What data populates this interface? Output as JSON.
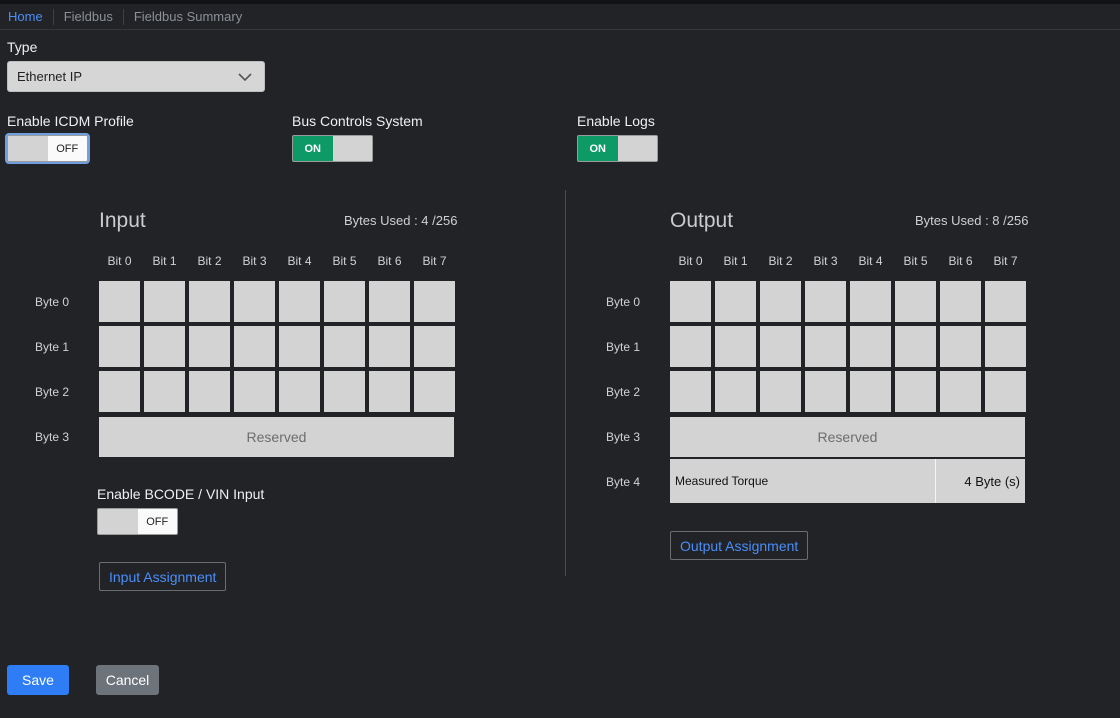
{
  "breadcrumb": [
    "Home",
    "Fieldbus",
    "Fieldbus Summary"
  ],
  "type": {
    "label": "Type",
    "value": "Ethernet IP"
  },
  "toggles": {
    "icdm": {
      "label": "Enable ICDM Profile",
      "state": "OFF"
    },
    "bus": {
      "label": "Bus Controls System",
      "state": "ON"
    },
    "logs": {
      "label": "Enable Logs",
      "state": "ON"
    }
  },
  "input": {
    "title": "Input",
    "bytes_used": "Bytes Used : 4 /256",
    "bits": [
      "Bit 0",
      "Bit 1",
      "Bit 2",
      "Bit 3",
      "Bit 4",
      "Bit 5",
      "Bit 6",
      "Bit 7"
    ],
    "bytes": [
      "Byte 0",
      "Byte 1",
      "Byte 2",
      "Byte 3"
    ],
    "reserved": "Reserved",
    "bcode_label": "Enable BCODE / VIN Input",
    "bcode_state": "OFF",
    "assign_button": "Input Assignment"
  },
  "output": {
    "title": "Output",
    "bytes_used": "Bytes Used : 8 /256",
    "bits": [
      "Bit 0",
      "Bit 1",
      "Bit 2",
      "Bit 3",
      "Bit 4",
      "Bit 5",
      "Bit 6",
      "Bit 7"
    ],
    "bytes": [
      "Byte 0",
      "Byte 1",
      "Byte 2",
      "Byte 3",
      "Byte 4"
    ],
    "reserved": "Reserved",
    "torque_name": "Measured Torque",
    "torque_size": "4 Byte (s)",
    "assign_button": "Output Assignment"
  },
  "actions": {
    "save": "Save",
    "cancel": "Cancel"
  }
}
